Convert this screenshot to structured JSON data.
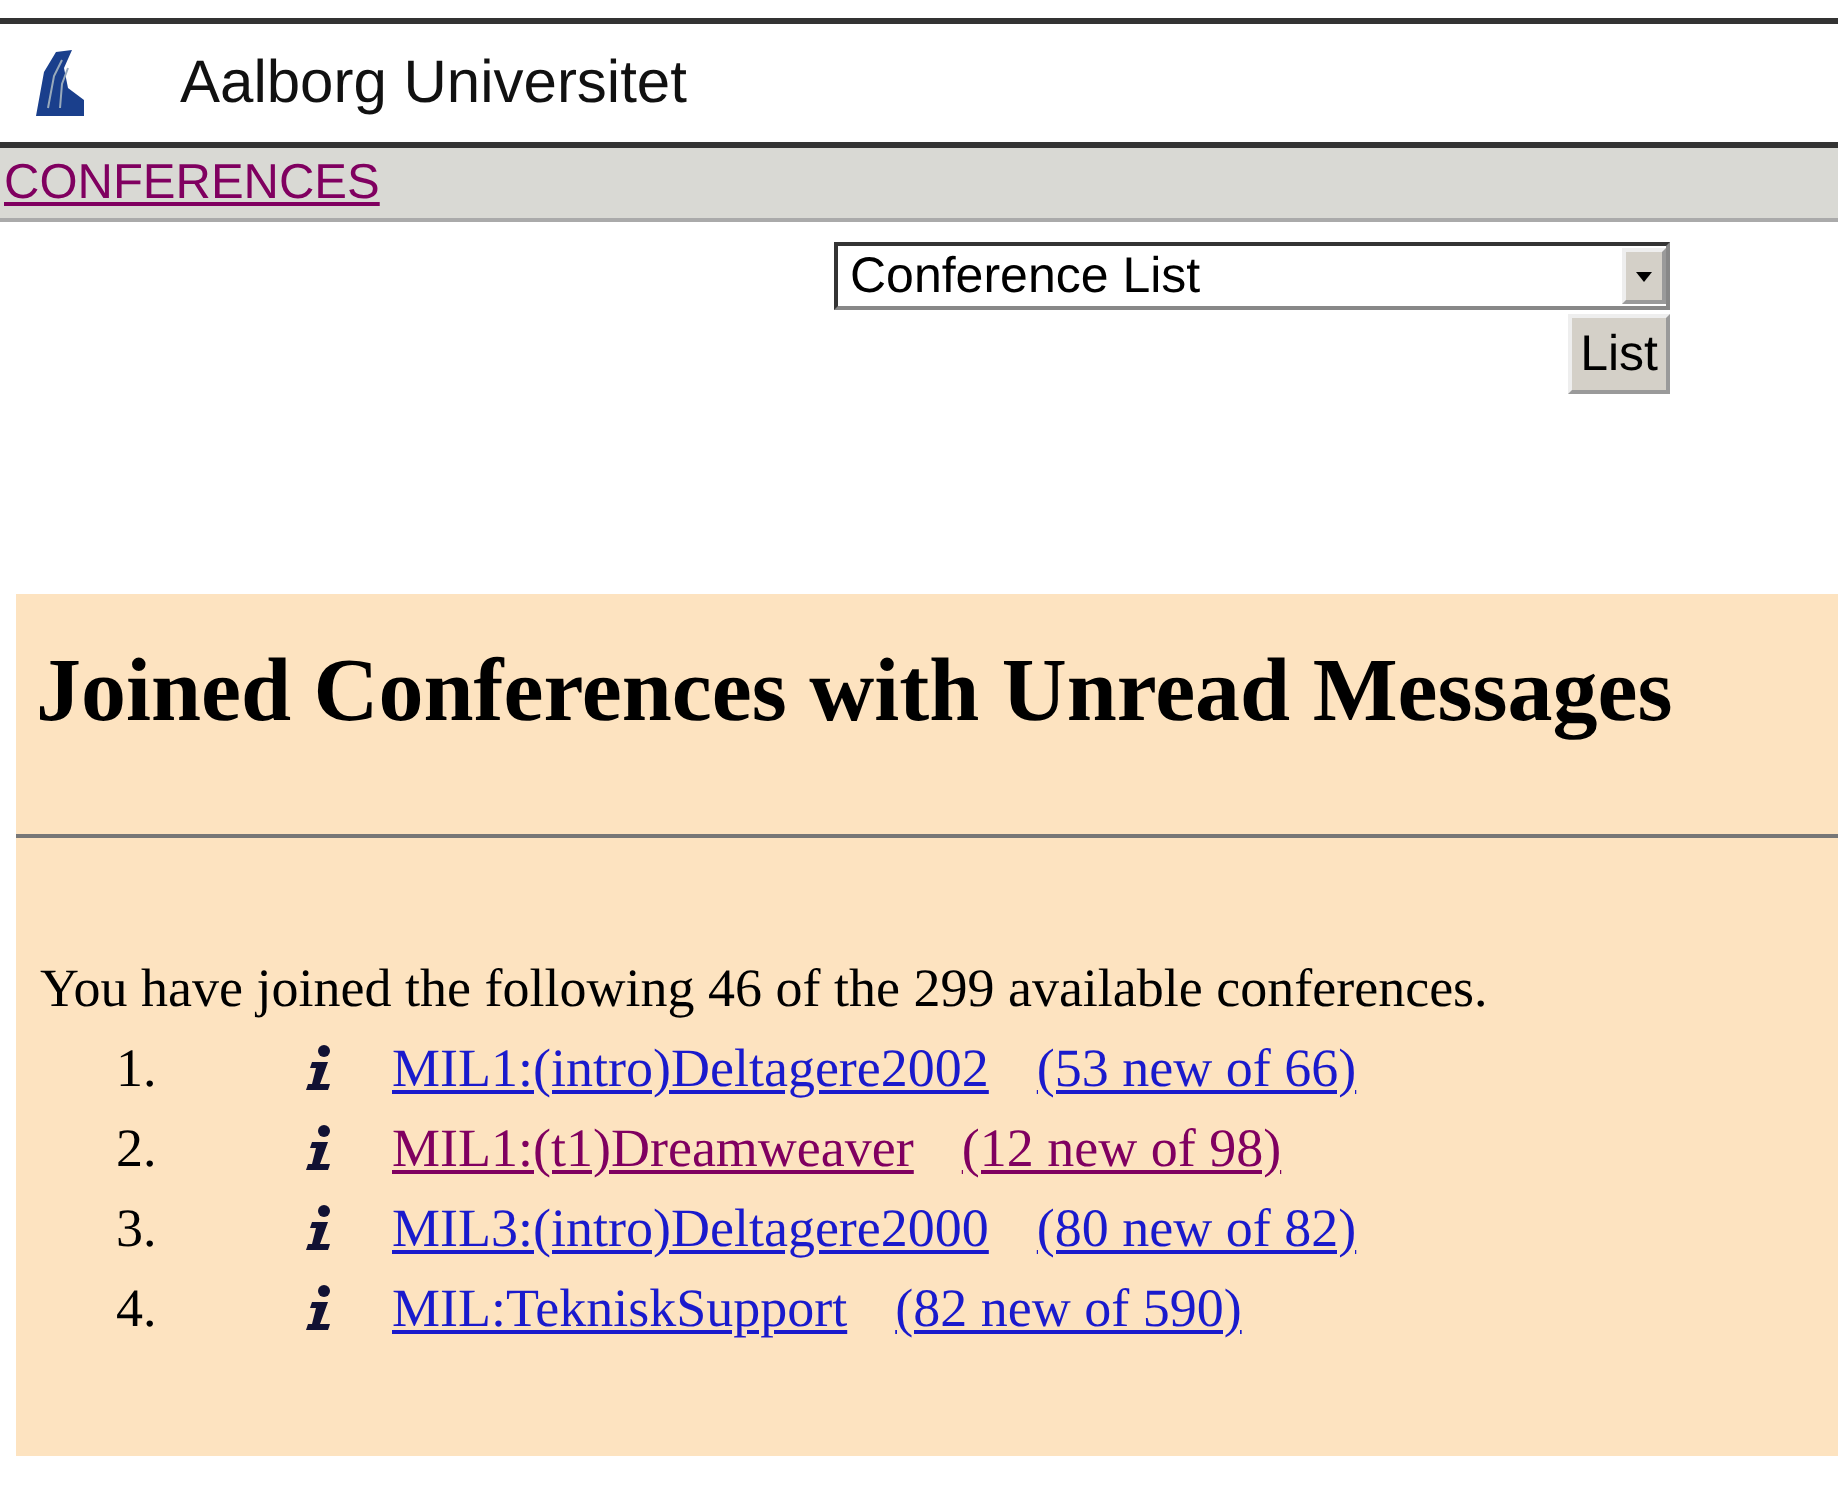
{
  "header": {
    "title": "Aalborg Universitet"
  },
  "nav": {
    "link": {
      "label": "CONFERENCES",
      "visited": true
    }
  },
  "form": {
    "select": {
      "value": "Conference List"
    },
    "button": "List"
  },
  "content": {
    "heading": "Joined Conferences with Unread Messages",
    "intro": "You have joined the following 46 of the 299 available conferences.",
    "conferences": [
      {
        "number": "1.",
        "name": "MIL1:(intro)Deltagere2002",
        "count": "(53 new of 66)",
        "visited": false
      },
      {
        "number": "2.",
        "name": "MIL1:(t1)Dreamweaver",
        "count": "(12 new of 98)",
        "visited": true
      },
      {
        "number": "3.",
        "name": "MIL3:(intro)Deltagere2000",
        "count": "(80 new of 82)",
        "visited": false
      },
      {
        "number": "4.",
        "name": "MIL:TekniskSupport",
        "count": "(82 new of 590)",
        "visited": false
      }
    ]
  }
}
